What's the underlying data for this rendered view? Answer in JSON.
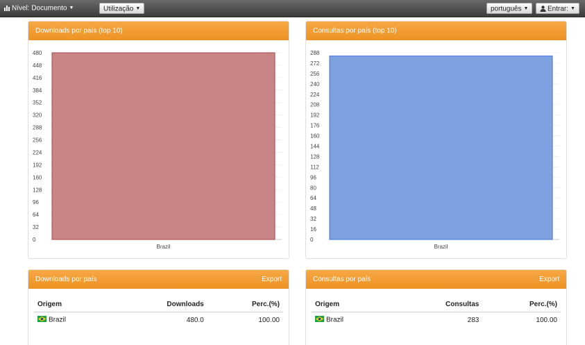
{
  "topbar": {
    "level_label": "Nível: Documento",
    "usage_label": "Utilização",
    "language_label": "português",
    "login_label": "Entrar:"
  },
  "downloads_chart": {
    "title": "Downloads por país (top 10)",
    "color": "#c98486",
    "stroke": "#a94448"
  },
  "queries_chart": {
    "title": "Consultas por país (top 10)",
    "color": "#7ea1e0",
    "stroke": "#3f72d6"
  },
  "chart_data": [
    {
      "type": "bar",
      "title": "Downloads por país (top 10)",
      "categories": [
        "Brazil"
      ],
      "values": [
        480
      ],
      "ylim": [
        0,
        480
      ],
      "yticks": [
        "0",
        "32",
        "64",
        "96",
        "128",
        "160",
        "192",
        "224",
        "256",
        "288",
        "320",
        "352",
        "384",
        "416",
        "448",
        "480"
      ],
      "grid": true
    },
    {
      "type": "bar",
      "title": "Consultas por país (top 10)",
      "categories": [
        "Brazil"
      ],
      "values": [
        283
      ],
      "ylim": [
        0,
        288
      ],
      "yticks": [
        "0",
        "16",
        "32",
        "48",
        "64",
        "80",
        "96",
        "112",
        "128",
        "144",
        "160",
        "176",
        "192",
        "208",
        "224",
        "240",
        "256",
        "272",
        "288"
      ],
      "grid": true
    }
  ],
  "downloads_table": {
    "title": "Downloads por país",
    "export_label": "Export",
    "headers": [
      "Origem",
      "Downloads",
      "Perc.(%)"
    ],
    "rows": [
      [
        "Brazil",
        "480.0",
        "100.00"
      ]
    ]
  },
  "queries_table": {
    "title": "Consultas por país",
    "export_label": "Export",
    "headers": [
      "Origem",
      "Consultas",
      "Perc.(%)"
    ],
    "rows": [
      [
        "Brazil",
        "283",
        "100.00"
      ]
    ]
  }
}
